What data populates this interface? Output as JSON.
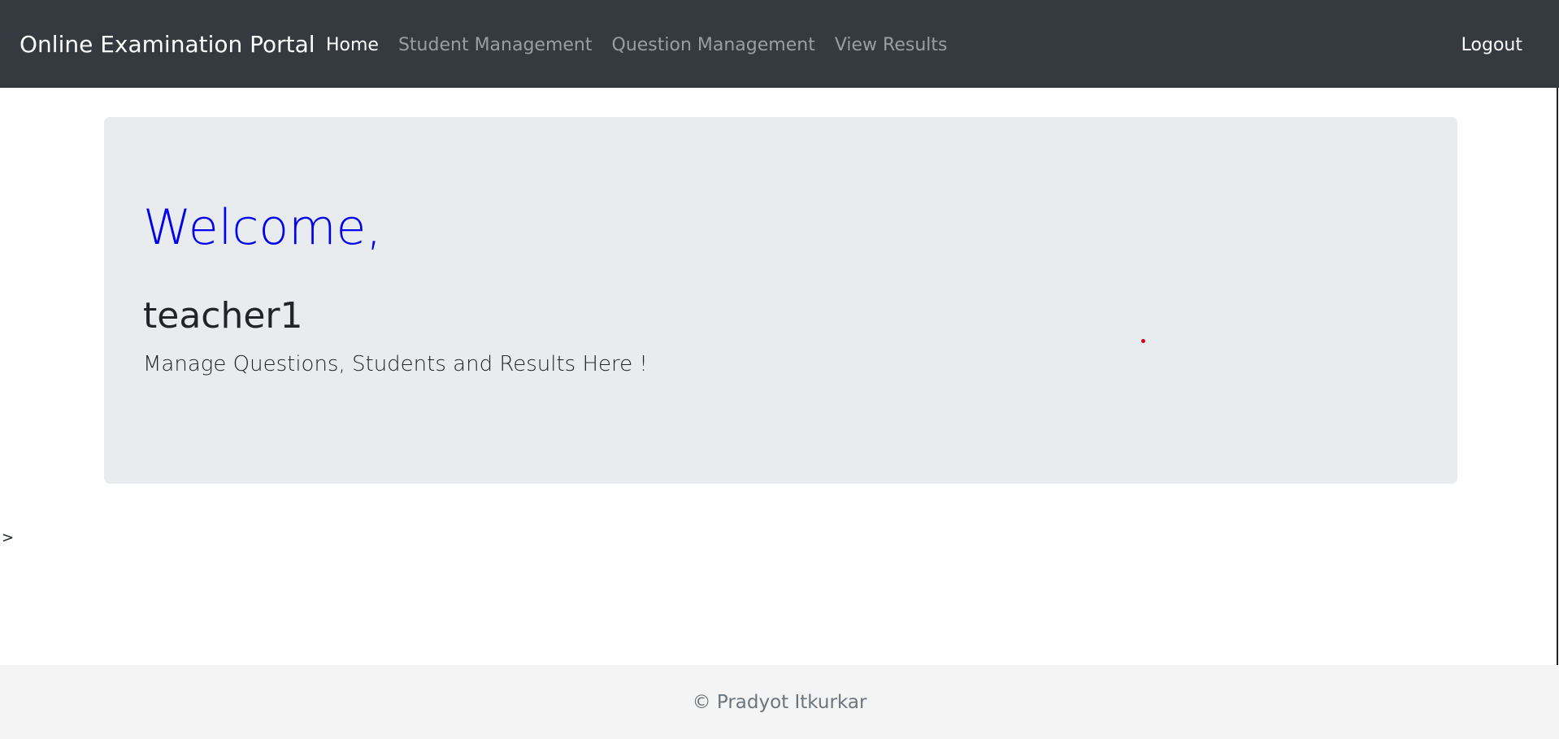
{
  "navbar": {
    "brand": "Online Examination Portal",
    "links": [
      {
        "label": "Home",
        "active": true
      },
      {
        "label": "Student Management",
        "active": false
      },
      {
        "label": "Question Management",
        "active": false
      },
      {
        "label": "View Results",
        "active": false
      }
    ],
    "logout_label": "Logout"
  },
  "jumbotron": {
    "welcome": "Welcome,",
    "username": "teacher1",
    "lead": "Manage Questions, Students and Results Here !"
  },
  "stray_text": ">",
  "footer": {
    "text": "© Pradyot Itkurkar"
  },
  "colors": {
    "navbar_bg": "#343a40",
    "welcome_color": "#0000ee",
    "jumbotron_bg": "#e9ecef",
    "footer_bg": "#f4f4f4",
    "cursor_dot": "#d0021b"
  }
}
